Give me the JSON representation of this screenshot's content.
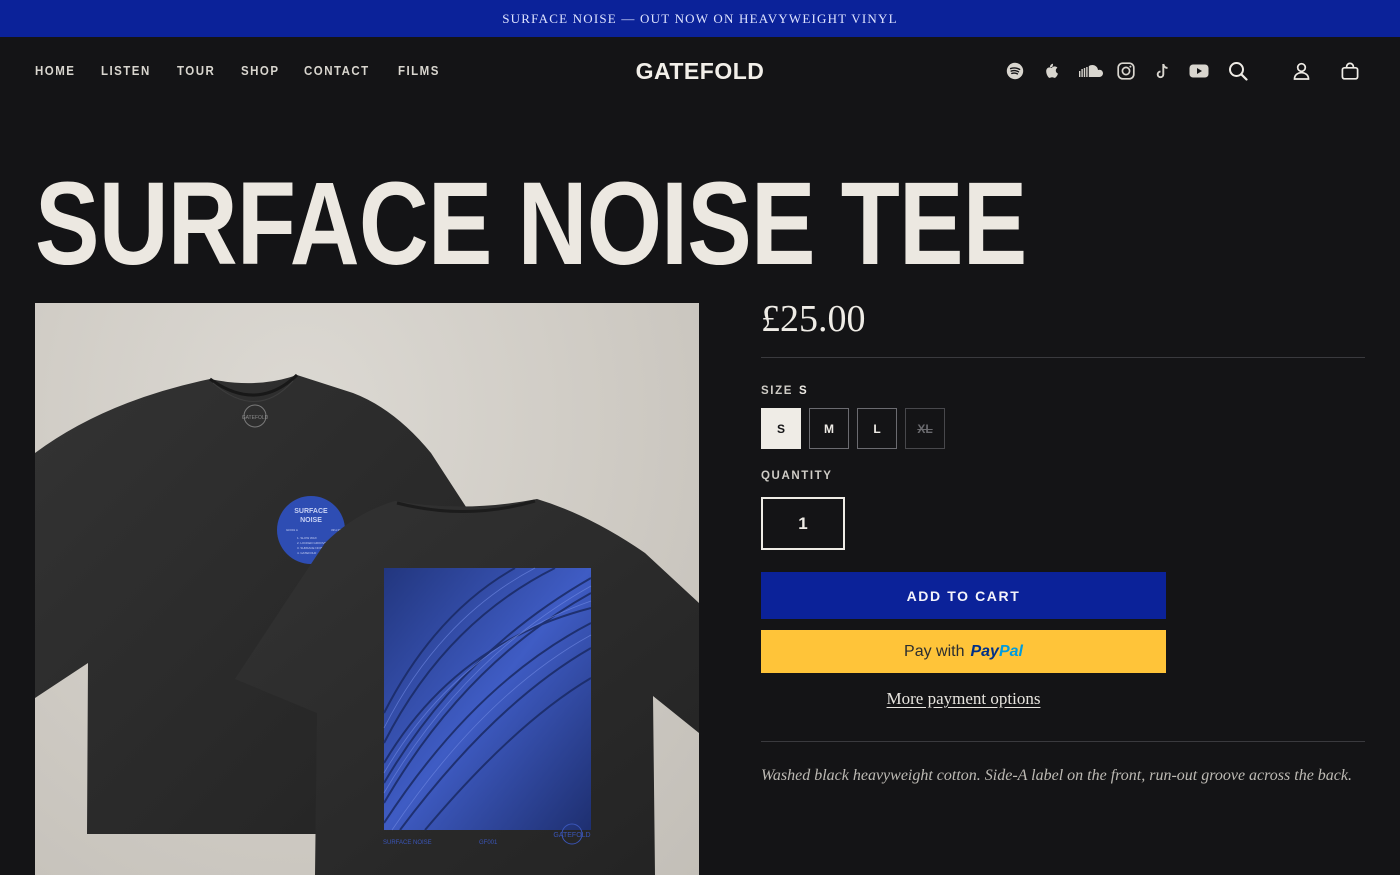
{
  "announcement": "SURFACE NOISE — OUT NOW ON HEAVYWEIGHT VINYL",
  "nav": {
    "items": [
      "HOME",
      "LISTEN",
      "TOUR",
      "SHOP",
      "CONTACT",
      "FILMS"
    ]
  },
  "brand": {
    "logo": "GATEFOLD"
  },
  "header_icons": [
    "spotify-icon",
    "apple-music-icon",
    "soundcloud-icon",
    "instagram-icon",
    "tiktok-icon",
    "youtube-icon",
    "search-icon",
    "account-icon",
    "cart-icon"
  ],
  "product": {
    "title": "SURFACE NOISE TEE",
    "price": "£25.00",
    "size_label": "SIZE",
    "size_selected": "S",
    "sizes": [
      {
        "label": "S",
        "state": "selected"
      },
      {
        "label": "M",
        "state": "available"
      },
      {
        "label": "L",
        "state": "available"
      },
      {
        "label": "XL",
        "state": "sold-out"
      }
    ],
    "quantity_label": "QUANTITY",
    "quantity": "1",
    "add_to_cart": "ADD TO CART",
    "paypal": {
      "prefix": "Pay with",
      "brand_a": "Pay",
      "brand_b": "Pal"
    },
    "more_payment": "More payment options",
    "description": "Washed black heavyweight cotton. Side-A label on the front, run-out groove across the back.",
    "image": {
      "front_label_title_1": "SURFACE",
      "front_label_title_2": "NOISE",
      "front_label_left": "GF001 A",
      "front_label_right": "33⅓ RPM",
      "front_tracks": [
        "1. SLOW WAX",
        "2. LOCKED GROOVE",
        "3. SURFACE NOISE",
        "4. GATEFOLD"
      ],
      "back_caption_left": "SURFACE NOISE",
      "back_caption_mid": "GF001",
      "back_logo": "GATEFOLD",
      "collar_logo": "GATEFOLD"
    }
  },
  "colors": {
    "background": "#141416",
    "accent": "#0b2299",
    "paypal": "#ffc439",
    "text": "#efece6"
  }
}
